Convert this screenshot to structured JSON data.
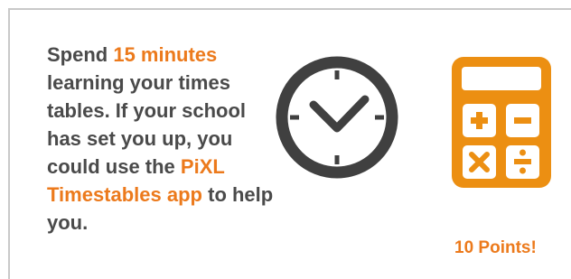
{
  "task": {
    "line_parts": [
      "Spend ",
      "15 minutes",
      " learning your times tables. If your school has set you up, you could use the ",
      "PiXL Timestables app",
      " to help you."
    ]
  },
  "reward": {
    "points_label": "10 Points!"
  },
  "icons": {
    "clock": "clock-icon",
    "calculator": "calculator-icon"
  },
  "colors": {
    "accent": "#ec7a1c",
    "text": "#4a4a4a",
    "icon_dark": "#404040",
    "border": "#c9c9c9"
  }
}
